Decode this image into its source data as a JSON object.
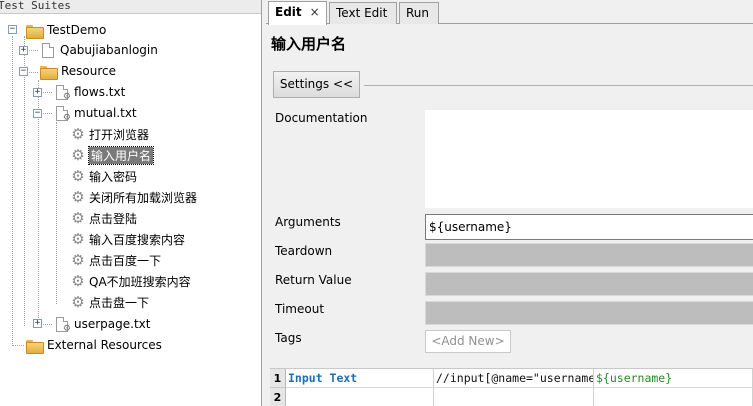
{
  "tree": {
    "header": "Test Suites",
    "root": "TestDemo",
    "items": [
      {
        "label": "Qabujiabanlogin"
      },
      {
        "label": "Resource"
      },
      {
        "label": "flows.txt"
      },
      {
        "label": "mutual.txt"
      },
      {
        "label": "userpage.txt"
      },
      {
        "label": "External Resources"
      }
    ],
    "keywords": [
      "打开浏览器",
      "输入用户名",
      "输入密码",
      "关闭所有加载浏览器",
      "点击登陆",
      "输入百度搜索内容",
      "点击百度一下",
      "QA不加班搜索内容",
      "点击盘一下"
    ],
    "selected_keyword": "输入用户名"
  },
  "tabs": [
    {
      "label": "Edit",
      "close": "×"
    },
    {
      "label": "Text Edit"
    },
    {
      "label": "Run"
    }
  ],
  "editor": {
    "title": "输入用户名",
    "settings_button": "Settings <<",
    "documentation_label": "Documentation",
    "arguments_label": "Arguments",
    "arguments_value": "${username}",
    "teardown_label": "Teardown",
    "return_value_label": "Return Value",
    "timeout_label": "Timeout",
    "tags_label": "Tags",
    "tags_add_new": "<Add New>"
  },
  "grid": {
    "rows": [
      {
        "num": "1",
        "cells": [
          "Input Text",
          "//input[@name=\"username",
          "${username}"
        ]
      },
      {
        "num": "2",
        "cells": [
          "",
          "",
          ""
        ]
      }
    ]
  },
  "colors": {
    "keyword": "#1e6eb4",
    "variable": "#2a8a2a",
    "selection": "#7a7a7a"
  }
}
